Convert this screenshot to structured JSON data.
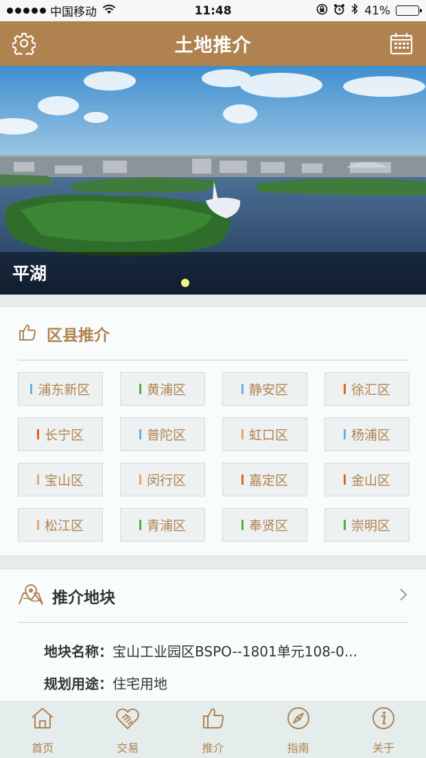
{
  "status_bar": {
    "carrier": "中国移动",
    "time": "11:48",
    "battery_text": "41%",
    "battery_level": 0.41
  },
  "navbar": {
    "title": "土地推介",
    "left_icon": "gear-icon",
    "right_icon": "calendar-icon"
  },
  "banner": {
    "caption": "平湖",
    "active_page": 1
  },
  "districts": {
    "title": "区县推介",
    "icon": "thumbs-up-icon",
    "items": [
      {
        "label": "浦东新区",
        "color": "#6aaede"
      },
      {
        "label": "黄浦区",
        "color": "#5aa83c"
      },
      {
        "label": "静安区",
        "color": "#6aaede"
      },
      {
        "label": "徐汇区",
        "color": "#e4601c"
      },
      {
        "label": "长宁区",
        "color": "#e4601c"
      },
      {
        "label": "普陀区",
        "color": "#6aaede"
      },
      {
        "label": "虹口区",
        "color": "#e0a878"
      },
      {
        "label": "杨浦区",
        "color": "#6aaede"
      },
      {
        "label": "宝山区",
        "color": "#e0a878"
      },
      {
        "label": "闵行区",
        "color": "#e0a878"
      },
      {
        "label": "嘉定区",
        "color": "#e4601c"
      },
      {
        "label": "金山区",
        "color": "#e4601c"
      },
      {
        "label": "松江区",
        "color": "#e0a878"
      },
      {
        "label": "青浦区",
        "color": "#5aa83c"
      },
      {
        "label": "奉贤区",
        "color": "#5aa83c"
      },
      {
        "label": "崇明区",
        "color": "#5aa83c"
      }
    ]
  },
  "parcel": {
    "title": "推介地块",
    "icon": "map-pin-icon",
    "name_key": "地块名称：",
    "name_value": "宝山工业园区BSPO--1801单元108-0...",
    "use_key": "规划用途：",
    "use_value": "住宅用地"
  },
  "tabs": [
    {
      "label": "首页",
      "icon": "home-icon"
    },
    {
      "label": "交易",
      "icon": "handshake-icon"
    },
    {
      "label": "推介",
      "icon": "thumbs-up-icon"
    },
    {
      "label": "指南",
      "icon": "compass-icon"
    },
    {
      "label": "关于",
      "icon": "info-icon"
    }
  ],
  "colors": {
    "brand": "#b0824f",
    "background": "#e4ecec",
    "card": "#f8fcfc"
  }
}
